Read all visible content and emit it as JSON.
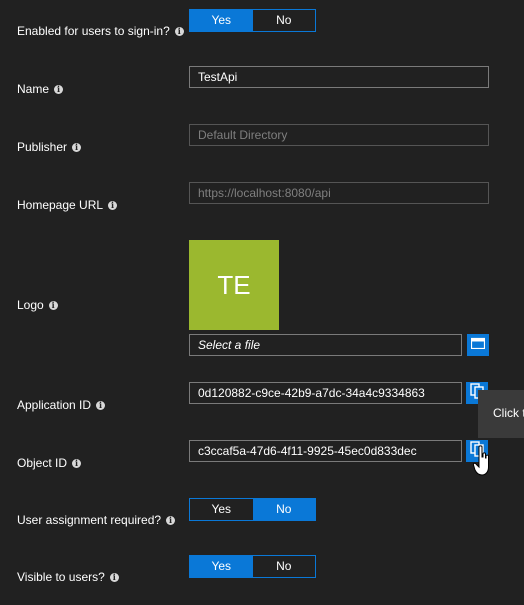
{
  "fields": {
    "enabled": {
      "label": "Enabled for users to sign-in?",
      "yes": "Yes",
      "no": "No",
      "selected": "Yes"
    },
    "name": {
      "label": "Name",
      "value": "TestApi"
    },
    "publisher": {
      "label": "Publisher",
      "placeholder": "Default Directory"
    },
    "homepage": {
      "label": "Homepage URL",
      "placeholder": "https://localhost:8080/api"
    },
    "logo": {
      "label": "Logo",
      "initials": "TE",
      "file_placeholder": "Select a file"
    },
    "application_id": {
      "label": "Application ID",
      "value": "0d120882-c9ce-42b9-a7dc-34a4c9334863"
    },
    "object_id": {
      "label": "Object ID",
      "value": "c3ccaf5a-47d6-4f11-9925-45ec0d833dec"
    },
    "user_assignment": {
      "label": "User assignment required?",
      "yes": "Yes",
      "no": "No",
      "selected": "No"
    },
    "visible": {
      "label": "Visible to users?",
      "yes": "Yes",
      "no": "No",
      "selected": "Yes"
    }
  },
  "tooltip": {
    "text": "Click t"
  },
  "icons": {
    "info": "info-icon",
    "file_browse": "folder-icon",
    "copy": "copy-icon",
    "cursor": "hand-pointer-icon"
  },
  "colors": {
    "background": "#212121",
    "accent": "#0a78d7",
    "logo_tile": "#9bb82f",
    "tooltip_bg": "#3a3a3a"
  }
}
